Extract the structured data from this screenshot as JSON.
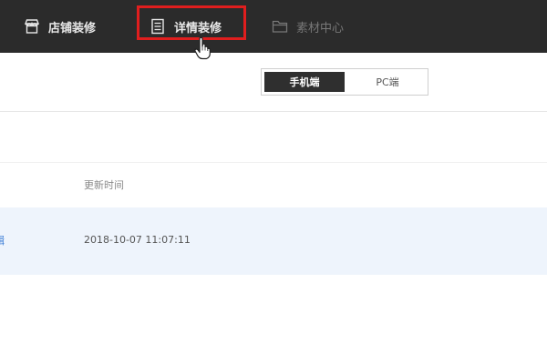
{
  "nav": {
    "shop_decor": "店铺装修",
    "detail_decor": "详情装修",
    "material_center": "素材中心"
  },
  "device_toggle": {
    "mobile": "手机端",
    "pc": "PC端"
  },
  "table": {
    "header_update_time": "更新时间",
    "rows": [
      {
        "name_fragment": "辑",
        "update_time": "2018-10-07 11:07:11"
      }
    ]
  },
  "colors": {
    "topbar_bg": "#2b2b2b",
    "highlight_red": "#e01e1e",
    "row_highlight": "#eef4fc",
    "link_blue": "#3a7bd5"
  },
  "icons": {
    "shop_decor": "storefront-icon",
    "detail_decor": "document-icon",
    "material_center": "folder-icon",
    "cursor": "hand-pointer-icon"
  }
}
